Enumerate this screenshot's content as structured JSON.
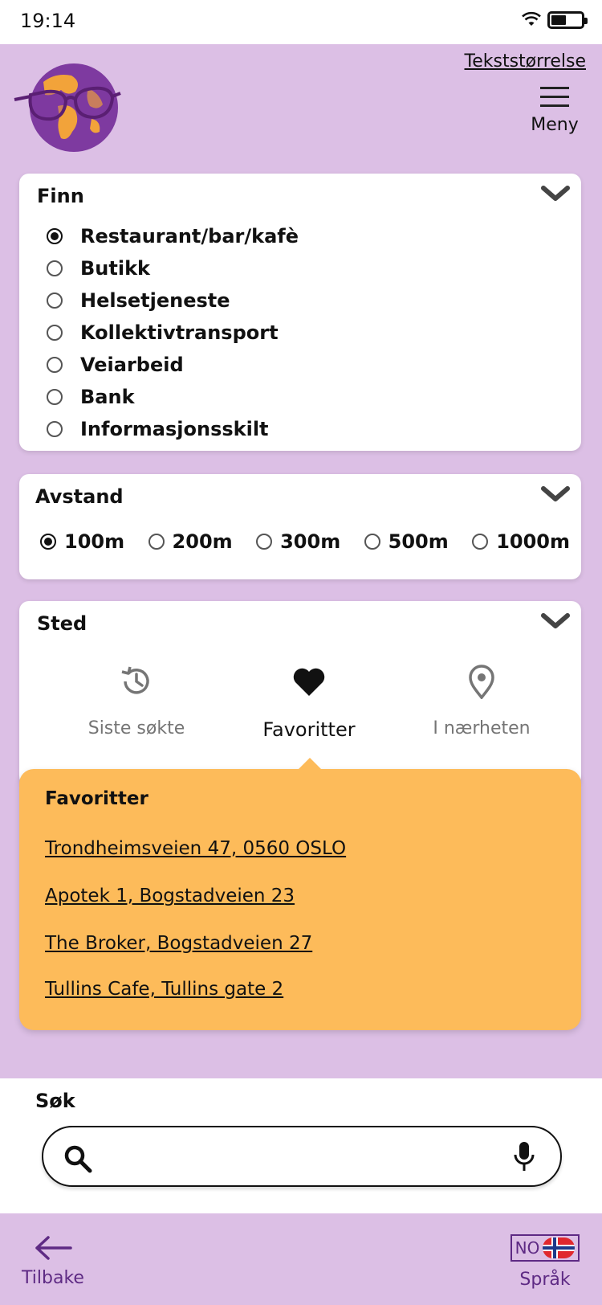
{
  "status_bar": {
    "time": "19:14"
  },
  "header": {
    "text_size_link": "Tekststørrelse",
    "menu_label": "Meny"
  },
  "finn": {
    "title": "Finn",
    "options": [
      "Restaurant/bar/kafè",
      "Butikk",
      "Helsetjeneste",
      "Kollektivtransport",
      "Veiarbeid",
      "Bank",
      "Informasjonsskilt"
    ],
    "selected": "Restaurant/bar/kafè"
  },
  "avstand": {
    "title": "Avstand",
    "options": [
      "100m",
      "200m",
      "300m",
      "500m",
      "1000m"
    ],
    "selected": "100m"
  },
  "sted": {
    "title": "Sted",
    "tabs": [
      {
        "label": "Siste søkte",
        "icon": "history-icon"
      },
      {
        "label": "Favoritter",
        "icon": "heart-icon"
      },
      {
        "label": "I nærheten",
        "icon": "location-icon"
      }
    ],
    "active_tab": "Favoritter"
  },
  "favorites": {
    "title": "Favoritter",
    "items": [
      "Trondheimsveien 47, 0560 OSLO",
      "Apotek 1, Bogstadveien 23",
      "The Broker, Bogstadveien 27",
      "Tullins Cafe, Tullins gate 2"
    ]
  },
  "search": {
    "label": "Søk",
    "value": "",
    "placeholder": ""
  },
  "footer": {
    "back_label": "Tilbake",
    "language_code": "NO",
    "language_label": "Språk"
  },
  "colors": {
    "background": "#dcbfe5",
    "accent_purple": "#5e2a84",
    "favorites_bg": "#fdbb5a"
  }
}
